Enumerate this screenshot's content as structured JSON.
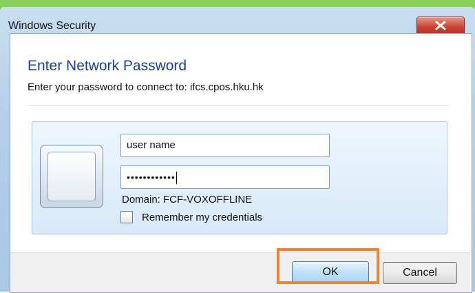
{
  "window": {
    "title": "Windows Security"
  },
  "dialog": {
    "heading": "Enter Network Password",
    "subtext": "Enter your password to connect to: ifcs.cpos.hku.hk"
  },
  "credentials": {
    "username_value": "user name",
    "password_masked": "••••••••••••",
    "domain_text": "Domain: FCF-VOXOFFLINE",
    "remember_label": "Remember my credentials",
    "remember_checked": false
  },
  "buttons": {
    "ok_label": "OK",
    "cancel_label": "Cancel"
  },
  "icons": {
    "close": "close-icon",
    "user_tile": "user-tile-icon"
  },
  "colors": {
    "title_bar": "#b3cfe8",
    "heading": "#1a3e9a",
    "close_button": "#c9432f",
    "highlight": "#f08332",
    "top_strip": "#8ad15a"
  }
}
